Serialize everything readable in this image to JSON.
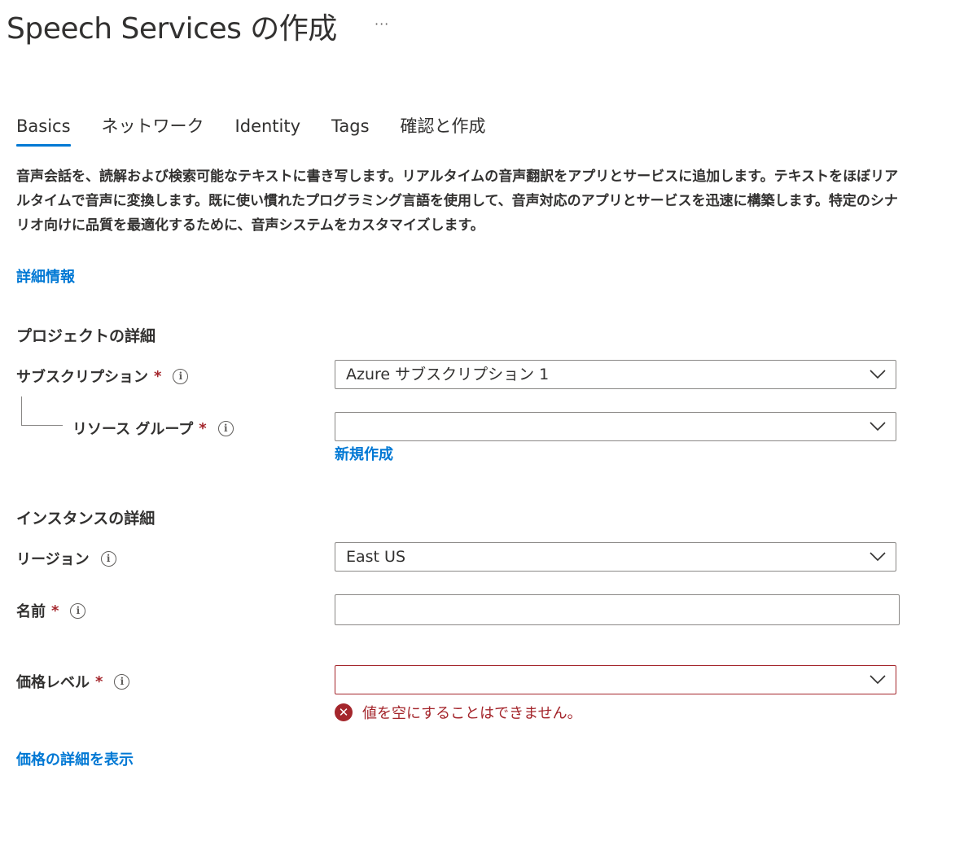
{
  "header": {
    "title": "Speech Services の作成",
    "more_label": "···"
  },
  "tabs": [
    {
      "label": "Basics"
    },
    {
      "label": "ネットワーク"
    },
    {
      "label": "Identity"
    },
    {
      "label": "Tags"
    },
    {
      "label": "確認と作成"
    }
  ],
  "active_tab": "Basics",
  "description": "音声会話を、読解および検索可能なテキストに書き写します。リアルタイムの音声翻訳をアプリとサービスに追加します。テキストをほぼリアルタイムで音声に変換します。既に使い慣れたプログラミング言語を使用して、音声対応のアプリとサービスを迅速に構築します。特定のシナリオ向けに品質を最適化するために、音声システムをカスタマイズします。",
  "learn_more_link": "詳細情報",
  "project": {
    "heading": "プロジェクトの詳細",
    "subscription": {
      "label": "サブスクリプション",
      "required": "*",
      "value": "Azure サブスクリプション 1"
    },
    "resource_group": {
      "label": "リソース グループ",
      "required": "*",
      "value": ""
    },
    "create_new_link": "新規作成"
  },
  "instance": {
    "heading": "インスタンスの詳細",
    "region": {
      "label": "リージョン",
      "value": "East US"
    },
    "name": {
      "label": "名前",
      "required": "*",
      "value": ""
    },
    "pricing_tier": {
      "label": "価格レベル",
      "required": "*",
      "value": ""
    },
    "error_message": "値を空にすることはできません。"
  },
  "pricing_details_link": "価格の詳細を表示",
  "icons": {
    "info": "info-icon",
    "chevron": "chevron-down-icon",
    "error": "error-icon",
    "more": "more-icon"
  },
  "colors": {
    "accent": "#0078d4",
    "error": "#a4262c",
    "text": "#323130"
  }
}
